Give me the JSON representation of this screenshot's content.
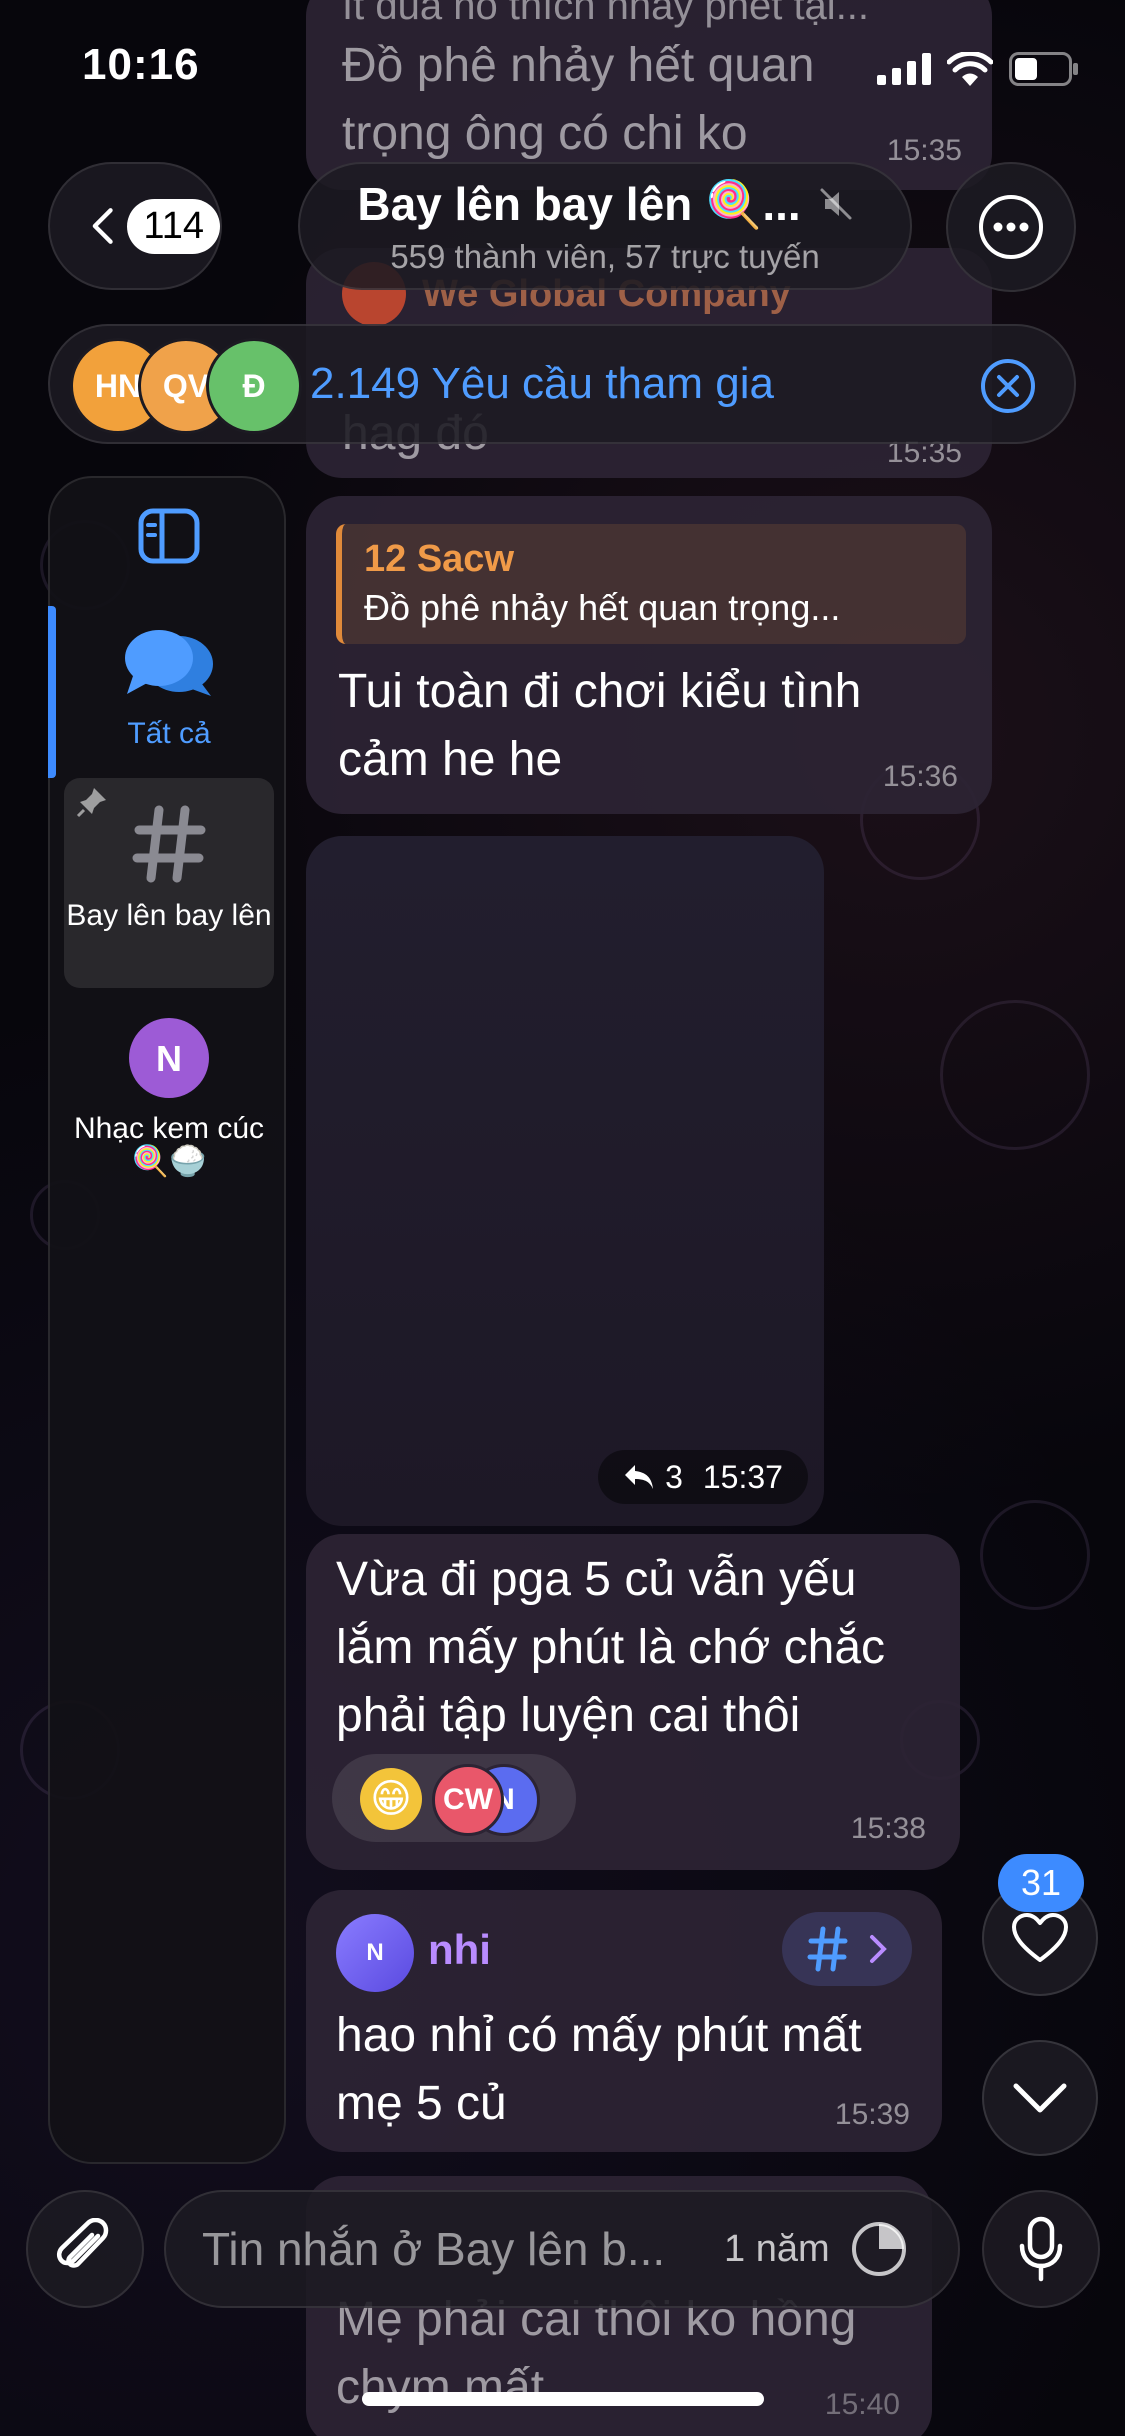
{
  "status_bar": {
    "time": "10:16"
  },
  "header": {
    "back_count": "114",
    "title": "Bay lên bay lên 🍭...",
    "subtitle": "559 thành viên, 57 trực tuyến"
  },
  "join_requests": {
    "text": "2.149 Yêu cầu tham gia",
    "avatars": [
      "HN",
      "QV",
      "Đ"
    ]
  },
  "sidebar": {
    "items": [
      {
        "label": "Tất cả",
        "icon": "chat-bubbles-icon"
      },
      {
        "label": "Bay lên bay lên",
        "icon": "hashtag-icon"
      },
      {
        "label": "Nhạc kem cúc 🍭🍚",
        "badge": "N"
      }
    ]
  },
  "behind_header_messages": {
    "partial_top": "It đua nó thích nhảy phét tại...",
    "msg1_lines": [
      "Đồ phê nhảy hết quan",
      "trọng ông có chi ko"
    ],
    "msg1_time": "15:35",
    "forwarded_from": "We Global Company",
    "msg2_tail": "hag đó",
    "msg2_time": "15:35"
  },
  "messages": [
    {
      "reply_name": "12 Sacw",
      "reply_snippet": "Đồ phê nhảy hết quan trọng...",
      "text_lines": [
        "Tui toàn đi chơi kiểu tình",
        "cảm he he"
      ],
      "time": "15:36"
    },
    {
      "type": "media",
      "reply_count": "3",
      "time": "15:37"
    },
    {
      "text_lines": [
        "Vừa đi pga 5 củ vẫn yếu",
        "lắm mấy phút là chớ chắc",
        "phải tập luyện cai thôi"
      ],
      "reaction_emoji": "😁",
      "reaction_avatars": [
        "CW",
        "N"
      ],
      "time": "15:38"
    },
    {
      "sender": "nhi",
      "sender_initial": "N",
      "text_lines": [
        "hao nhỉ có mấy phút mất",
        "mẹ 5 củ"
      ],
      "time": "15:39"
    },
    {
      "text_lines": [
        "Mẹ phải cai thôi ko hồng",
        "chym mất"
      ],
      "time": "15:40"
    }
  ],
  "floating": {
    "unread_count": "31"
  },
  "input": {
    "placeholder": "Tin nhắn ở Bay lên b...",
    "timer": "1 năm"
  },
  "colors": {
    "accent": "#3d8bff",
    "reply_accent": "#e08a3a",
    "bubble": "#2c2434"
  }
}
